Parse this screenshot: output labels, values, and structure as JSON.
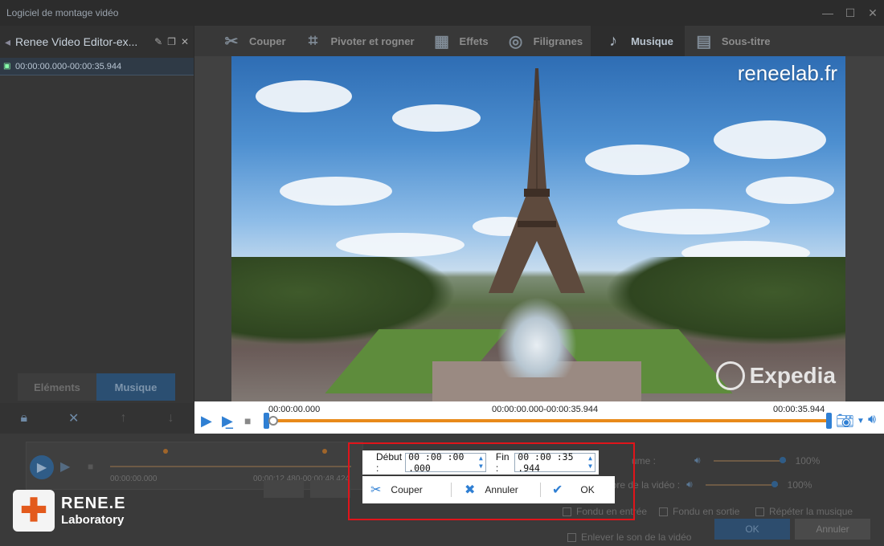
{
  "window": {
    "title": "Logiciel de montage vidéo",
    "controls": [
      "—",
      "☐",
      "✕"
    ]
  },
  "project": {
    "name": "Renee Video Editor-ex...",
    "clip_range": "00:00:00.000-00:00:35.944"
  },
  "toolbar": {
    "items": [
      {
        "label": "Couper",
        "icon": "scissors-icon"
      },
      {
        "label": "Pivoter et rogner",
        "icon": "crop-icon"
      },
      {
        "label": "Effets",
        "icon": "film-effects-icon"
      },
      {
        "label": "Filigranes",
        "icon": "film-reel-icon"
      },
      {
        "label": "Musique",
        "icon": "music-note-icon"
      },
      {
        "label": "Sous-titre",
        "icon": "subtitle-icon"
      }
    ],
    "active": "Musique"
  },
  "video": {
    "watermark": "reneelab.fr",
    "corner_logo": "Expedia"
  },
  "timeline": {
    "start": "00:00:00.000",
    "range": "00:00:00.000-00:00:35.944",
    "end": "00:00:35.944"
  },
  "left_tabs": [
    "Eléments",
    "Musique"
  ],
  "mini_player": {
    "start": "00:00:00.000",
    "range": "00:00:12.480-00:00:48.424"
  },
  "settings": {
    "volume_label": "ume :",
    "volume_value": "100%",
    "sound_label": "Volume sonore de la vidéo :",
    "sound_value": "100%",
    "fade_in": "Fondu en entrée",
    "fade_out": "Fondu en sortie",
    "repeat": "Répéter la musique",
    "remove_sound": "Enlever le son de la vidéo",
    "ok": "OK",
    "cancel": "Annuler"
  },
  "cut_dialog": {
    "start_label": "Début :",
    "start_value": "00 :00 :00 .000",
    "end_label": "Fin :",
    "end_value": "00 :00 :35 .944",
    "cut_button": "Couper",
    "cancel_button": "Annuler",
    "ok_button": "OK"
  },
  "brand": {
    "line1": "RENE.E",
    "line2": "Laboratory"
  },
  "colors": {
    "accent": "#2f7fd3",
    "track": "#e88a1a",
    "highlight": "#e0141a"
  }
}
